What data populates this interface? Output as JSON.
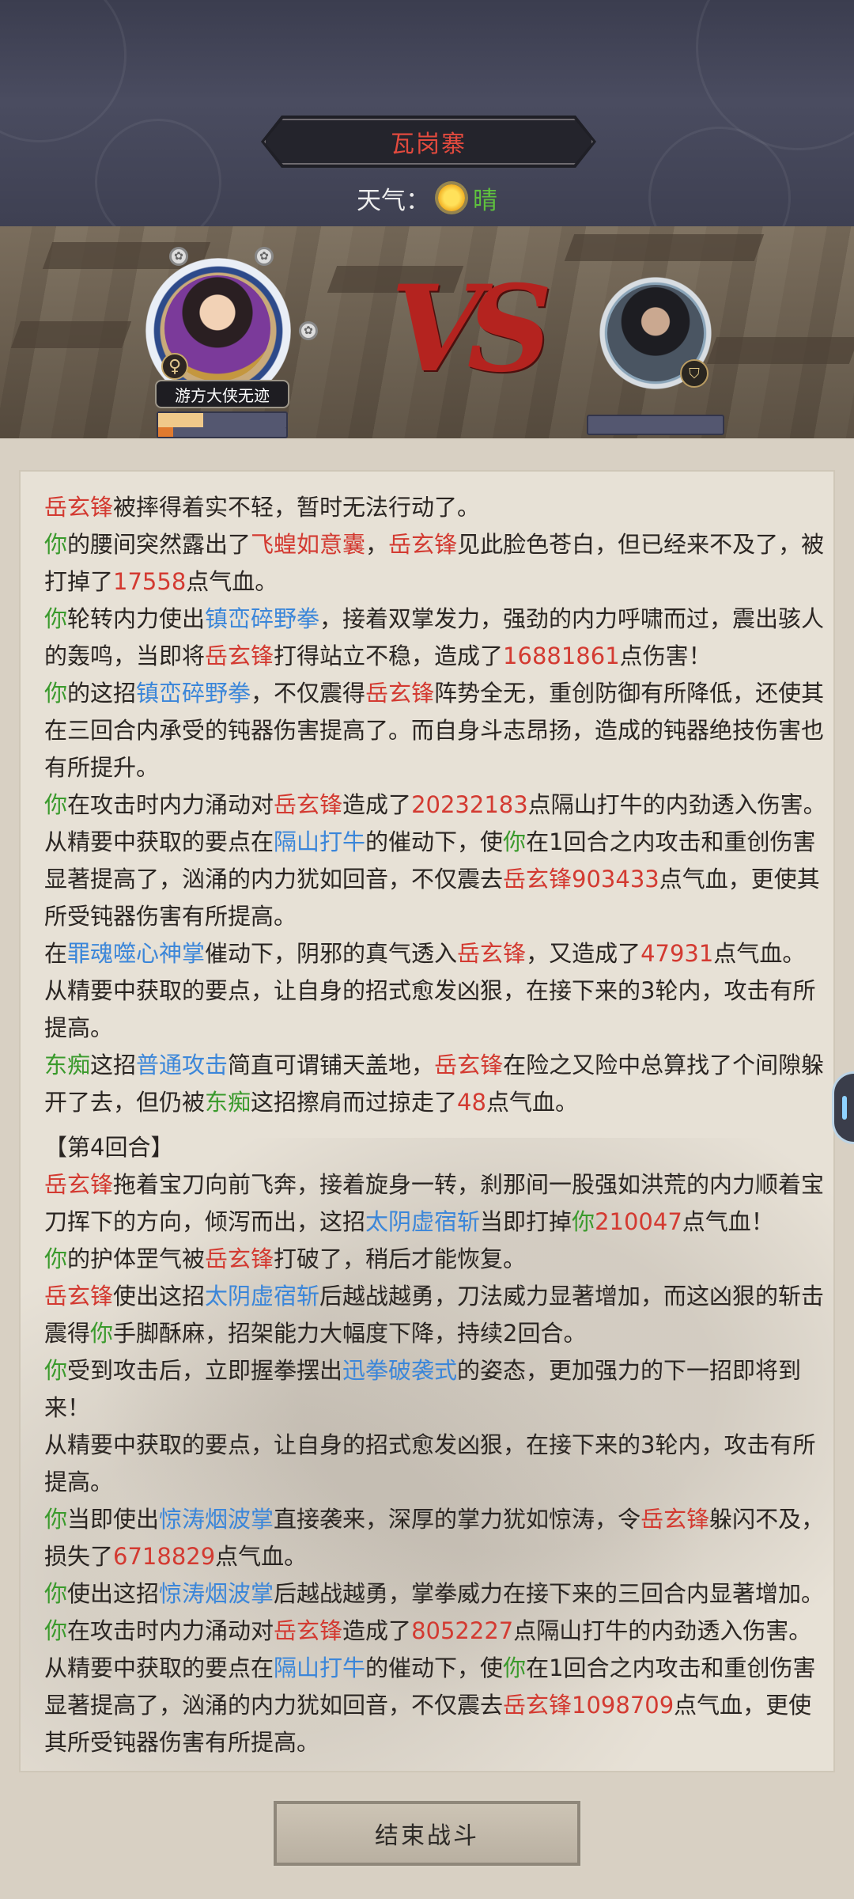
{
  "location": {
    "name": "瓦岗寨"
  },
  "weather": {
    "label": "天气：",
    "value": "晴",
    "icon": "sun-icon"
  },
  "battle": {
    "player": {
      "name": "游方大侠无迹",
      "gender_icon": "♀",
      "hp_fraction": 0.35,
      "mp_fraction": 0.12,
      "hp_color": "#f0c98a",
      "mp_color": "#e07a2f"
    },
    "vs_text": "VS",
    "enemy": {
      "badge_icon": "shield-icon",
      "hp_fraction": 0
    }
  },
  "log": [
    [
      [
        "c-red",
        "岳玄锋"
      ],
      [
        "c-default",
        "被摔得着实不轻，暂时无法行动了。"
      ]
    ],
    [
      [
        "c-green",
        "你"
      ],
      [
        "c-default",
        "的腰间突然露出了"
      ],
      [
        "c-red",
        "飞蝗如意囊"
      ],
      [
        "c-default",
        "，"
      ],
      [
        "c-red",
        "岳玄锋"
      ],
      [
        "c-default",
        "见此脸色苍白，但已经来不及了，被打掉了"
      ],
      [
        "c-red",
        "17558"
      ],
      [
        "c-default",
        "点气血。"
      ]
    ],
    [
      [
        "c-green",
        "你"
      ],
      [
        "c-default",
        "轮转内力使出"
      ],
      [
        "c-blue",
        "镇峦碎野拳"
      ],
      [
        "c-default",
        "，接着双掌发力，强劲的内力呼啸而过，震出骇人的轰鸣，当即将"
      ],
      [
        "c-red",
        "岳玄锋"
      ],
      [
        "c-default",
        "打得站立不稳，造成了"
      ],
      [
        "c-red",
        "16881861"
      ],
      [
        "c-default",
        "点伤害！"
      ]
    ],
    [
      [
        "c-green",
        "你"
      ],
      [
        "c-default",
        "的这招"
      ],
      [
        "c-blue",
        "镇峦碎野拳"
      ],
      [
        "c-default",
        "，不仅震得"
      ],
      [
        "c-red",
        "岳玄锋"
      ],
      [
        "c-default",
        "阵势全无，重创防御有所降低，还使其在三回合内承受的钝器伤害提高了。而自身斗志昂扬，造成的钝器绝技伤害也有所提升。"
      ]
    ],
    [
      [
        "c-green",
        "你"
      ],
      [
        "c-default",
        "在攻击时内力涌动对"
      ],
      [
        "c-red",
        "岳玄锋"
      ],
      [
        "c-default",
        "造成了"
      ],
      [
        "c-red",
        "20232183"
      ],
      [
        "c-default",
        "点隔山打牛的内劲透入伤害。"
      ]
    ],
    [
      [
        "c-default",
        "从精要中获取的要点在"
      ],
      [
        "c-blue",
        "隔山打牛"
      ],
      [
        "c-default",
        "的催动下，使"
      ],
      [
        "c-green",
        "你"
      ],
      [
        "c-default",
        "在1回合之内攻击和重创伤害显著提高了，汹涌的内力犹如回音，不仅震去"
      ],
      [
        "c-red",
        "岳玄锋903433"
      ],
      [
        "c-default",
        "点气血，更使其所受钝器伤害有所提高。"
      ]
    ],
    [
      [
        "c-default",
        "在"
      ],
      [
        "c-blue",
        "罪魂噬心神掌"
      ],
      [
        "c-default",
        "催动下，阴邪的真气透入"
      ],
      [
        "c-red",
        "岳玄锋"
      ],
      [
        "c-default",
        "，又造成了"
      ],
      [
        "c-red",
        "47931"
      ],
      [
        "c-default",
        "点气血。"
      ]
    ],
    [
      [
        "c-default",
        "从精要中获取的要点，让自身的招式愈发凶狠，在接下来的3轮内，攻击有所提高。"
      ]
    ],
    [
      [
        "c-green",
        "东痴"
      ],
      [
        "c-default",
        "这招"
      ],
      [
        "c-blue",
        "普通攻击"
      ],
      [
        "c-default",
        "简直可谓铺天盖地，"
      ],
      [
        "c-red",
        "岳玄锋"
      ],
      [
        "c-default",
        "在险之又险中总算找了个间隙躲开了去，但仍被"
      ],
      [
        "c-green",
        "东痴"
      ],
      [
        "c-default",
        "这招擦肩而过掠走了"
      ],
      [
        "c-red",
        "48"
      ],
      [
        "c-default",
        "点气血。"
      ]
    ],
    [
      [
        "c-default",
        "【第4回合】"
      ]
    ],
    [
      [
        "c-red",
        "岳玄锋"
      ],
      [
        "c-default",
        "拖着宝刀向前飞奔，接着旋身一转，刹那间一股强如洪荒的内力顺着宝刀挥下的方向，倾泻而出，这招"
      ],
      [
        "c-blue",
        "太阴虚宿斩"
      ],
      [
        "c-default",
        "当即打掉"
      ],
      [
        "c-green",
        "你"
      ],
      [
        "c-red",
        "210047"
      ],
      [
        "c-default",
        "点气血！"
      ]
    ],
    [
      [
        "c-green",
        "你"
      ],
      [
        "c-default",
        "的护体罡气被"
      ],
      [
        "c-red",
        "岳玄锋"
      ],
      [
        "c-default",
        "打破了，稍后才能恢复。"
      ]
    ],
    [
      [
        "c-red",
        "岳玄锋"
      ],
      [
        "c-default",
        "使出这招"
      ],
      [
        "c-blue",
        "太阴虚宿斩"
      ],
      [
        "c-default",
        "后越战越勇，刀法威力显著增加，而这凶狠的斩击震得"
      ],
      [
        "c-green",
        "你"
      ],
      [
        "c-default",
        "手脚酥麻，招架能力大幅度下降，持续2回合。"
      ]
    ],
    [
      [
        "c-green",
        "你"
      ],
      [
        "c-default",
        "受到攻击后，立即握拳摆出"
      ],
      [
        "c-blue",
        "迅拳破袭式"
      ],
      [
        "c-default",
        "的姿态，更加强力的下一招即将到来！"
      ]
    ],
    [
      [
        "c-default",
        "从精要中获取的要点，让自身的招式愈发凶狠，在接下来的3轮内，攻击有所提高。"
      ]
    ],
    [
      [
        "c-green",
        "你"
      ],
      [
        "c-default",
        "当即使出"
      ],
      [
        "c-blue",
        "惊涛烟波掌"
      ],
      [
        "c-default",
        "直接袭来，深厚的掌力犹如惊涛，令"
      ],
      [
        "c-red",
        "岳玄锋"
      ],
      [
        "c-default",
        "躲闪不及，损失了"
      ],
      [
        "c-red",
        "6718829"
      ],
      [
        "c-default",
        "点气血。"
      ]
    ],
    [
      [
        "c-green",
        "你"
      ],
      [
        "c-default",
        "使出这招"
      ],
      [
        "c-blue",
        "惊涛烟波掌"
      ],
      [
        "c-default",
        "后越战越勇，掌拳威力在接下来的三回合内显著增加。"
      ]
    ],
    [
      [
        "c-green",
        "你"
      ],
      [
        "c-default",
        "在攻击时内力涌动对"
      ],
      [
        "c-red",
        "岳玄锋"
      ],
      [
        "c-default",
        "造成了"
      ],
      [
        "c-red",
        "8052227"
      ],
      [
        "c-default",
        "点隔山打牛的内劲透入伤害。"
      ]
    ],
    [
      [
        "c-default",
        "从精要中获取的要点在"
      ],
      [
        "c-blue",
        "隔山打牛"
      ],
      [
        "c-default",
        "的催动下，使"
      ],
      [
        "c-green",
        "你"
      ],
      [
        "c-default",
        "在1回合之内攻击和重创伤害显著提高了，汹涌的内力犹如回音，不仅震去"
      ],
      [
        "c-red",
        "岳玄锋1098709"
      ],
      [
        "c-default",
        "点气血，更使其所受钝器伤害有所提高。"
      ]
    ]
  ],
  "footer": {
    "end_button_label": "结束战斗"
  }
}
